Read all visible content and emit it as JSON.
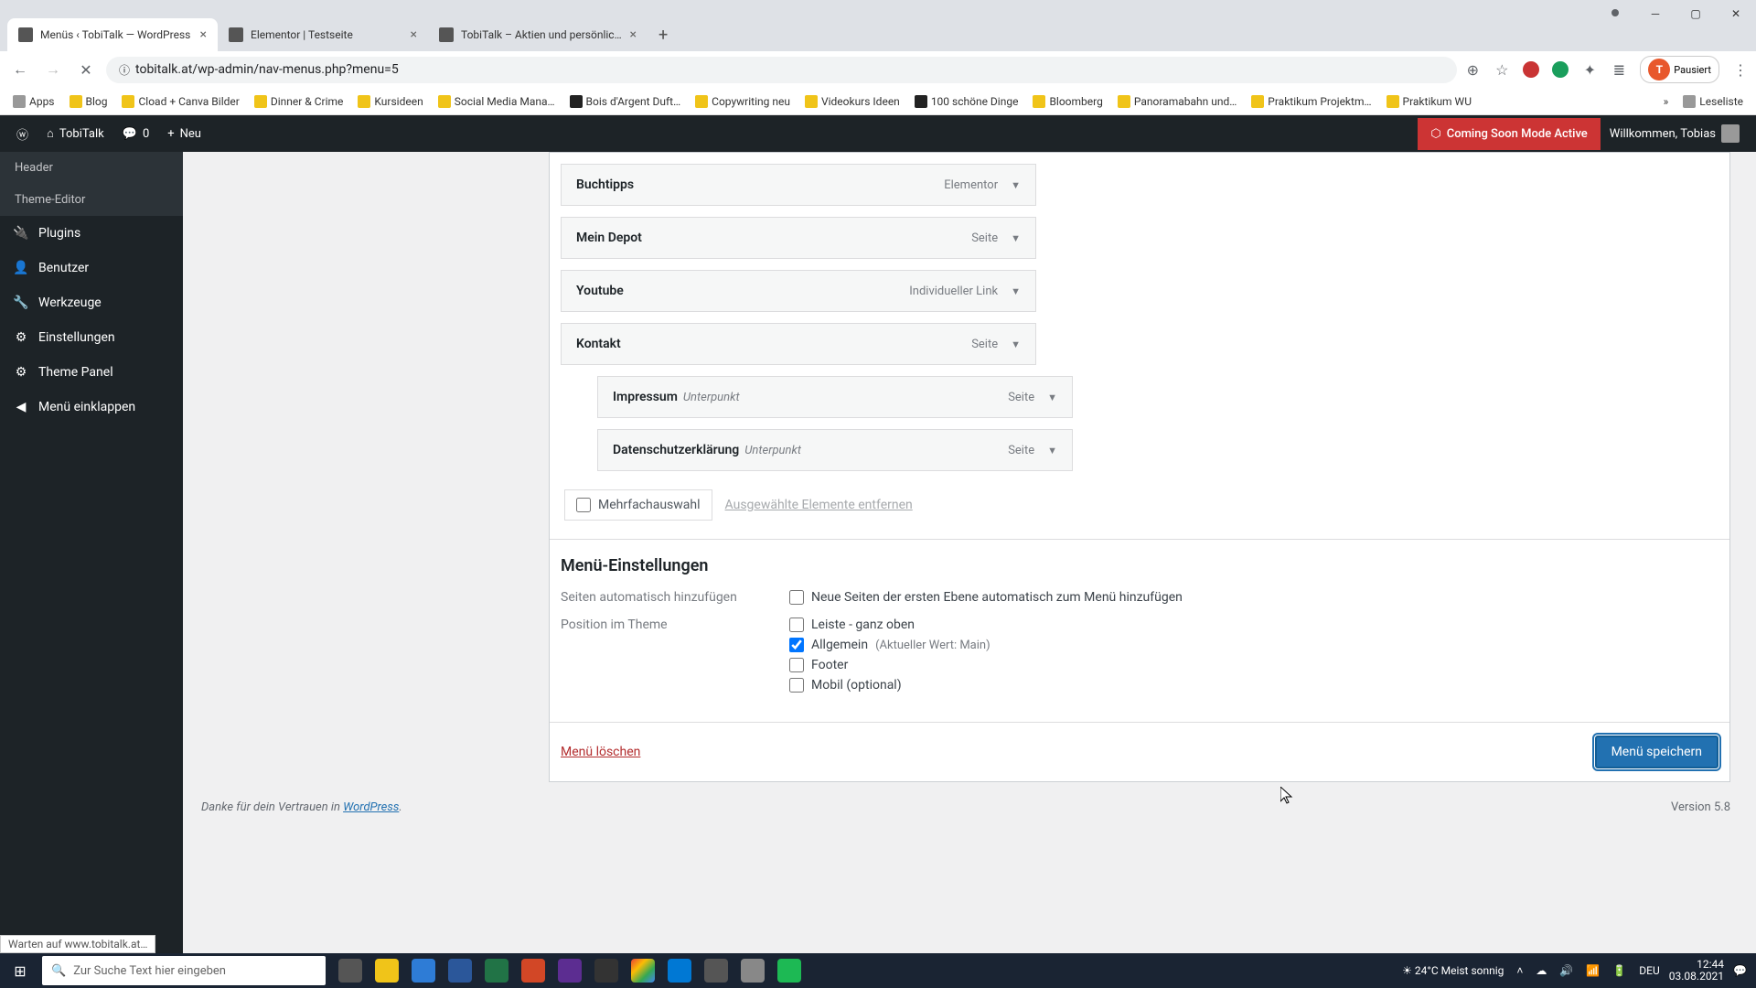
{
  "browser": {
    "tabs": [
      {
        "title": "Menüs ‹ TobiTalk — WordPress",
        "active": true
      },
      {
        "title": "Elementor | Testseite",
        "active": false
      },
      {
        "title": "TobiTalk – Aktien und persönlich…",
        "active": false
      }
    ],
    "url": "tobitalk.at/wp-admin/nav-menus.php?menu=5",
    "paused": "Pausiert",
    "profileInitial": "T"
  },
  "bookmarks": [
    "Apps",
    "Blog",
    "Cload + Canva Bilder",
    "Dinner & Crime",
    "Kursideen",
    "Social Media Mana…",
    "Bois d'Argent Duft…",
    "Copywriting neu",
    "Videokurs Ideen",
    "100 schöne Dinge",
    "Bloomberg",
    "Panoramabahn und…",
    "Praktikum Projektm…",
    "Praktikum WU"
  ],
  "bookmarksTail": "Leseliste",
  "wpBar": {
    "site": "TobiTalk",
    "comments": "0",
    "new": "Neu",
    "comingSoon": "Coming Soon Mode Active",
    "welcome": "Willkommen, Tobias"
  },
  "sidebar": [
    {
      "label": "Header",
      "sub": true,
      "icon": ""
    },
    {
      "label": "Theme-Editor",
      "sub": true,
      "icon": ""
    },
    {
      "label": "Plugins",
      "sub": false,
      "icon": "plug"
    },
    {
      "label": "Benutzer",
      "sub": false,
      "icon": "user"
    },
    {
      "label": "Werkzeuge",
      "sub": false,
      "icon": "wrench"
    },
    {
      "label": "Einstellungen",
      "sub": false,
      "icon": "sliders"
    },
    {
      "label": "Theme Panel",
      "sub": false,
      "icon": "gear"
    },
    {
      "label": "Menü einklappen",
      "sub": false,
      "icon": "collapse"
    }
  ],
  "menuItems": [
    {
      "title": "Buchtipps",
      "type": "Elementor",
      "sub": false
    },
    {
      "title": "Mein Depot",
      "type": "Seite",
      "sub": false
    },
    {
      "title": "Youtube",
      "type": "Individueller Link",
      "sub": false
    },
    {
      "title": "Kontakt",
      "type": "Seite",
      "sub": false
    },
    {
      "title": "Impressum",
      "subtitle": "Unterpunkt",
      "type": "Seite",
      "sub": true
    },
    {
      "title": "Datenschutzerklärung",
      "subtitle": "Unterpunkt",
      "type": "Seite",
      "sub": true
    }
  ],
  "bulk": {
    "multi": "Mehrfachauswahl",
    "remove": "Ausgewählte Elemente entfernen"
  },
  "settings": {
    "heading": "Menü-Einstellungen",
    "autoAddLabel": "Seiten automatisch hinzufügen",
    "autoAddOption": "Neue Seiten der ersten Ebene automatisch zum Menü hinzufügen",
    "positionLabel": "Position im Theme",
    "positions": [
      {
        "label": "Leiste - ganz oben",
        "checked": false
      },
      {
        "label": "Allgemein",
        "value": "(Aktueller Wert: Main)",
        "checked": true
      },
      {
        "label": "Footer",
        "checked": false
      },
      {
        "label": "Mobil (optional)",
        "checked": false
      }
    ]
  },
  "actions": {
    "delete": "Menü löschen",
    "save": "Menü speichern"
  },
  "footer": {
    "thanks": "Danke für dein Vertrauen in ",
    "wp": "WordPress",
    "version": "Version 5.8"
  },
  "status": "Warten auf www.tobitalk.at…",
  "taskbar": {
    "searchPlaceholder": "Zur Suche Text hier eingeben",
    "weather": "24°C  Meist sonnig",
    "lang": "DEU",
    "time": "12:44",
    "date": "03.08.2021"
  }
}
